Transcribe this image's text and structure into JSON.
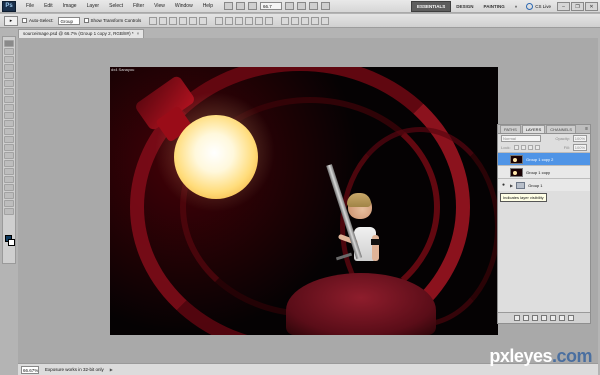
{
  "app": {
    "logo": "Ps",
    "menu": [
      "File",
      "Edit",
      "Image",
      "Layer",
      "Select",
      "Filter",
      "View",
      "Window",
      "Help"
    ],
    "zoom_select": "66.7",
    "workspaces": [
      "ESSENTIALS",
      "DESIGN",
      "PAINTING",
      "»"
    ],
    "cs_live": "CS Live",
    "window_controls": [
      "–",
      "❐",
      "✕"
    ]
  },
  "options": {
    "tool_preset": "▸",
    "auto_select_label": "Auto-Select:",
    "auto_select_value": "Group",
    "transform_controls_label": "Show Transform Controls"
  },
  "document": {
    "tab_title": "sourceimage.psd @ 66.7% (Group 1 copy 2, RGB/8#) *",
    "tab_close": "×",
    "canvas_label": "dx4 Sanayou"
  },
  "status": {
    "zoom": "66.67%",
    "message": "Exposure works in 32-bit only",
    "arrow": "▶"
  },
  "layers_panel": {
    "tabs": [
      "PATHS",
      "LAYERS",
      "CHANNELS"
    ],
    "menu_icon": "≡",
    "blend_mode": "Normal",
    "opacity_label": "Opacity:",
    "opacity_value": "100%",
    "lock_label": "Lock:",
    "fill_label": "Fill:",
    "fill_value": "100%",
    "layers": [
      {
        "name": "Group 1 copy 2",
        "selected": true,
        "type": "layer"
      },
      {
        "name": "Group 1 copy",
        "selected": false,
        "type": "layer"
      },
      {
        "name": "Group 1",
        "selected": false,
        "type": "group"
      }
    ],
    "tooltip": "Indicates layer visibility"
  },
  "watermark": {
    "name": "pxleyes",
    "tld": ".com"
  },
  "colors": {
    "foreground": "#0f3a5f",
    "background": "#ffffff",
    "selection": "#4f94e6"
  }
}
